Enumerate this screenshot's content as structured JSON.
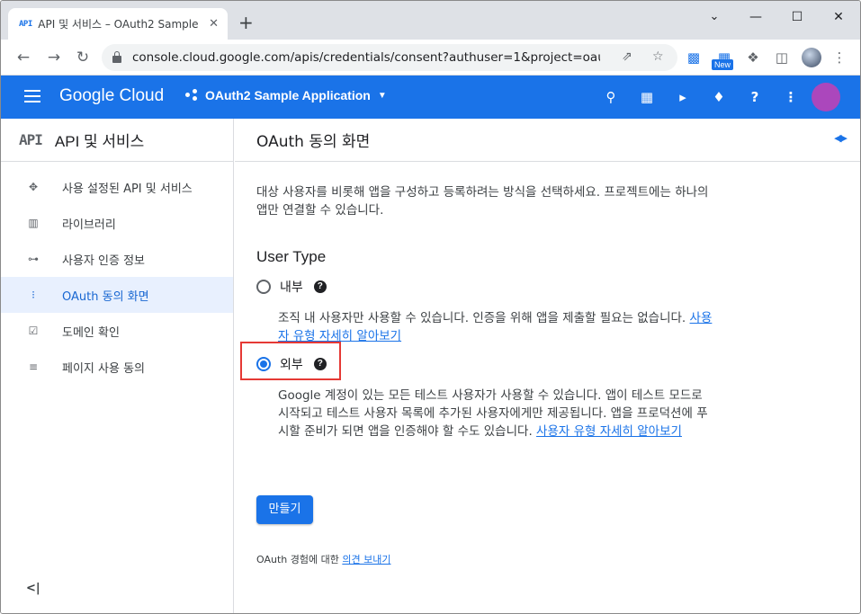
{
  "browser": {
    "tab_favicon": "API",
    "tab_title": "API 및 서비스 – OAuth2 Sample",
    "tab_close": "✕",
    "new_tab": "+",
    "window_controls": {
      "minimize": "—",
      "maximize": "☐",
      "close": "✕",
      "tab_search": "⌄"
    },
    "url": "console.cloud.google.com/apis/credentials/consent?authuser=1&project=oauth2-s...",
    "extension_badge": "New"
  },
  "header": {
    "logo": "Google Cloud",
    "project": "OAuth2 Sample Application",
    "accent": "#1a73e8",
    "avatar_color": "#ab47bc"
  },
  "sidebar": {
    "api_glyph": "API",
    "title": "API 및 서비스",
    "items": [
      {
        "label": "사용 설정된 API 및 서비스",
        "icon": "enabled-apis-icon",
        "glyph": "✥"
      },
      {
        "label": "라이브러리",
        "icon": "library-icon",
        "glyph": "▥"
      },
      {
        "label": "사용자 인증 정보",
        "icon": "key-icon",
        "glyph": "⊶"
      },
      {
        "label": "OAuth 동의 화면",
        "icon": "consent-icon",
        "glyph": "⁝",
        "active": true
      },
      {
        "label": "도메인 확인",
        "icon": "checkbox-icon",
        "glyph": "☑"
      },
      {
        "label": "페이지 사용 동의",
        "icon": "settings-list-icon",
        "glyph": "≡"
      }
    ],
    "collapse": "<|"
  },
  "main": {
    "title": "OAuth 동의 화면",
    "intro": "대상 사용자를 비롯해 앱을 구성하고 등록하려는 방식을 선택하세요. 프로젝트에는 하나의 앱만 연결할 수 있습니다.",
    "user_type_title": "User Type",
    "internal": {
      "label": "내부",
      "desc": "조직 내 사용자만 사용할 수 있습니다. 인증을 위해 앱을 제출할 필요는 없습니다.",
      "link": "사용자 유형 자세히 알아보기",
      "selected": false
    },
    "external": {
      "label": "외부",
      "desc": "Google 계정이 있는 모든 테스트 사용자가 사용할 수 있습니다. 앱이 테스트 모드로 시작되고 테스트 사용자 목록에 추가된 사용자에게만 제공됩니다. 앱을 프로덕션에 푸시할 준비가 되면 앱을 인증해야 할 수도 있습니다.",
      "link": "사용자 유형 자세히 알아보기",
      "selected": true
    },
    "create_button": "만들기",
    "feedback_text": "OAuth 경험에 대한",
    "feedback_link": "의견 보내기"
  }
}
